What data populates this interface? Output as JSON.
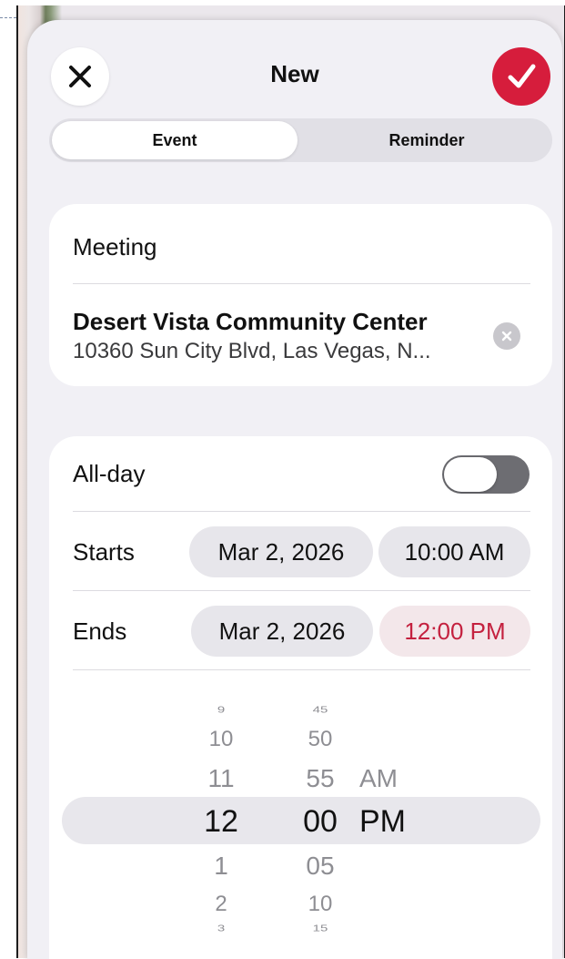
{
  "header": {
    "title": "New",
    "close_icon": "close-x-icon",
    "confirm_icon": "checkmark-icon"
  },
  "tabs": [
    {
      "label": "Event",
      "selected": true
    },
    {
      "label": "Reminder",
      "selected": false
    }
  ],
  "details": {
    "title_value": "Meeting",
    "location_name": "Desert Vista Community Center",
    "location_address": "10360 Sun City Blvd, Las Vegas, N...",
    "clear_icon": "clear-circle-icon"
  },
  "schedule": {
    "allday_label": "All-day",
    "allday_on": false,
    "starts_label": "Starts",
    "starts_date": "Mar 2, 2026",
    "starts_time": "10:00 AM",
    "ends_label": "Ends",
    "ends_date": "Mar 2, 2026",
    "ends_time": "12:00 PM"
  },
  "picker": {
    "hours_above": [
      "9",
      "10",
      "11"
    ],
    "hour_selected": "12",
    "hours_below": [
      "1",
      "2",
      "3"
    ],
    "minutes_above": [
      "45",
      "50",
      "55"
    ],
    "minute_selected": "00",
    "minutes_below": [
      "05",
      "10",
      "15"
    ],
    "ampm_above": "AM",
    "ampm_selected": "PM"
  },
  "colors": {
    "accent": "#d61d3c",
    "accent_text": "#c4213f",
    "sheet_bg": "#f1f0f5",
    "card_bg": "#ffffff"
  }
}
